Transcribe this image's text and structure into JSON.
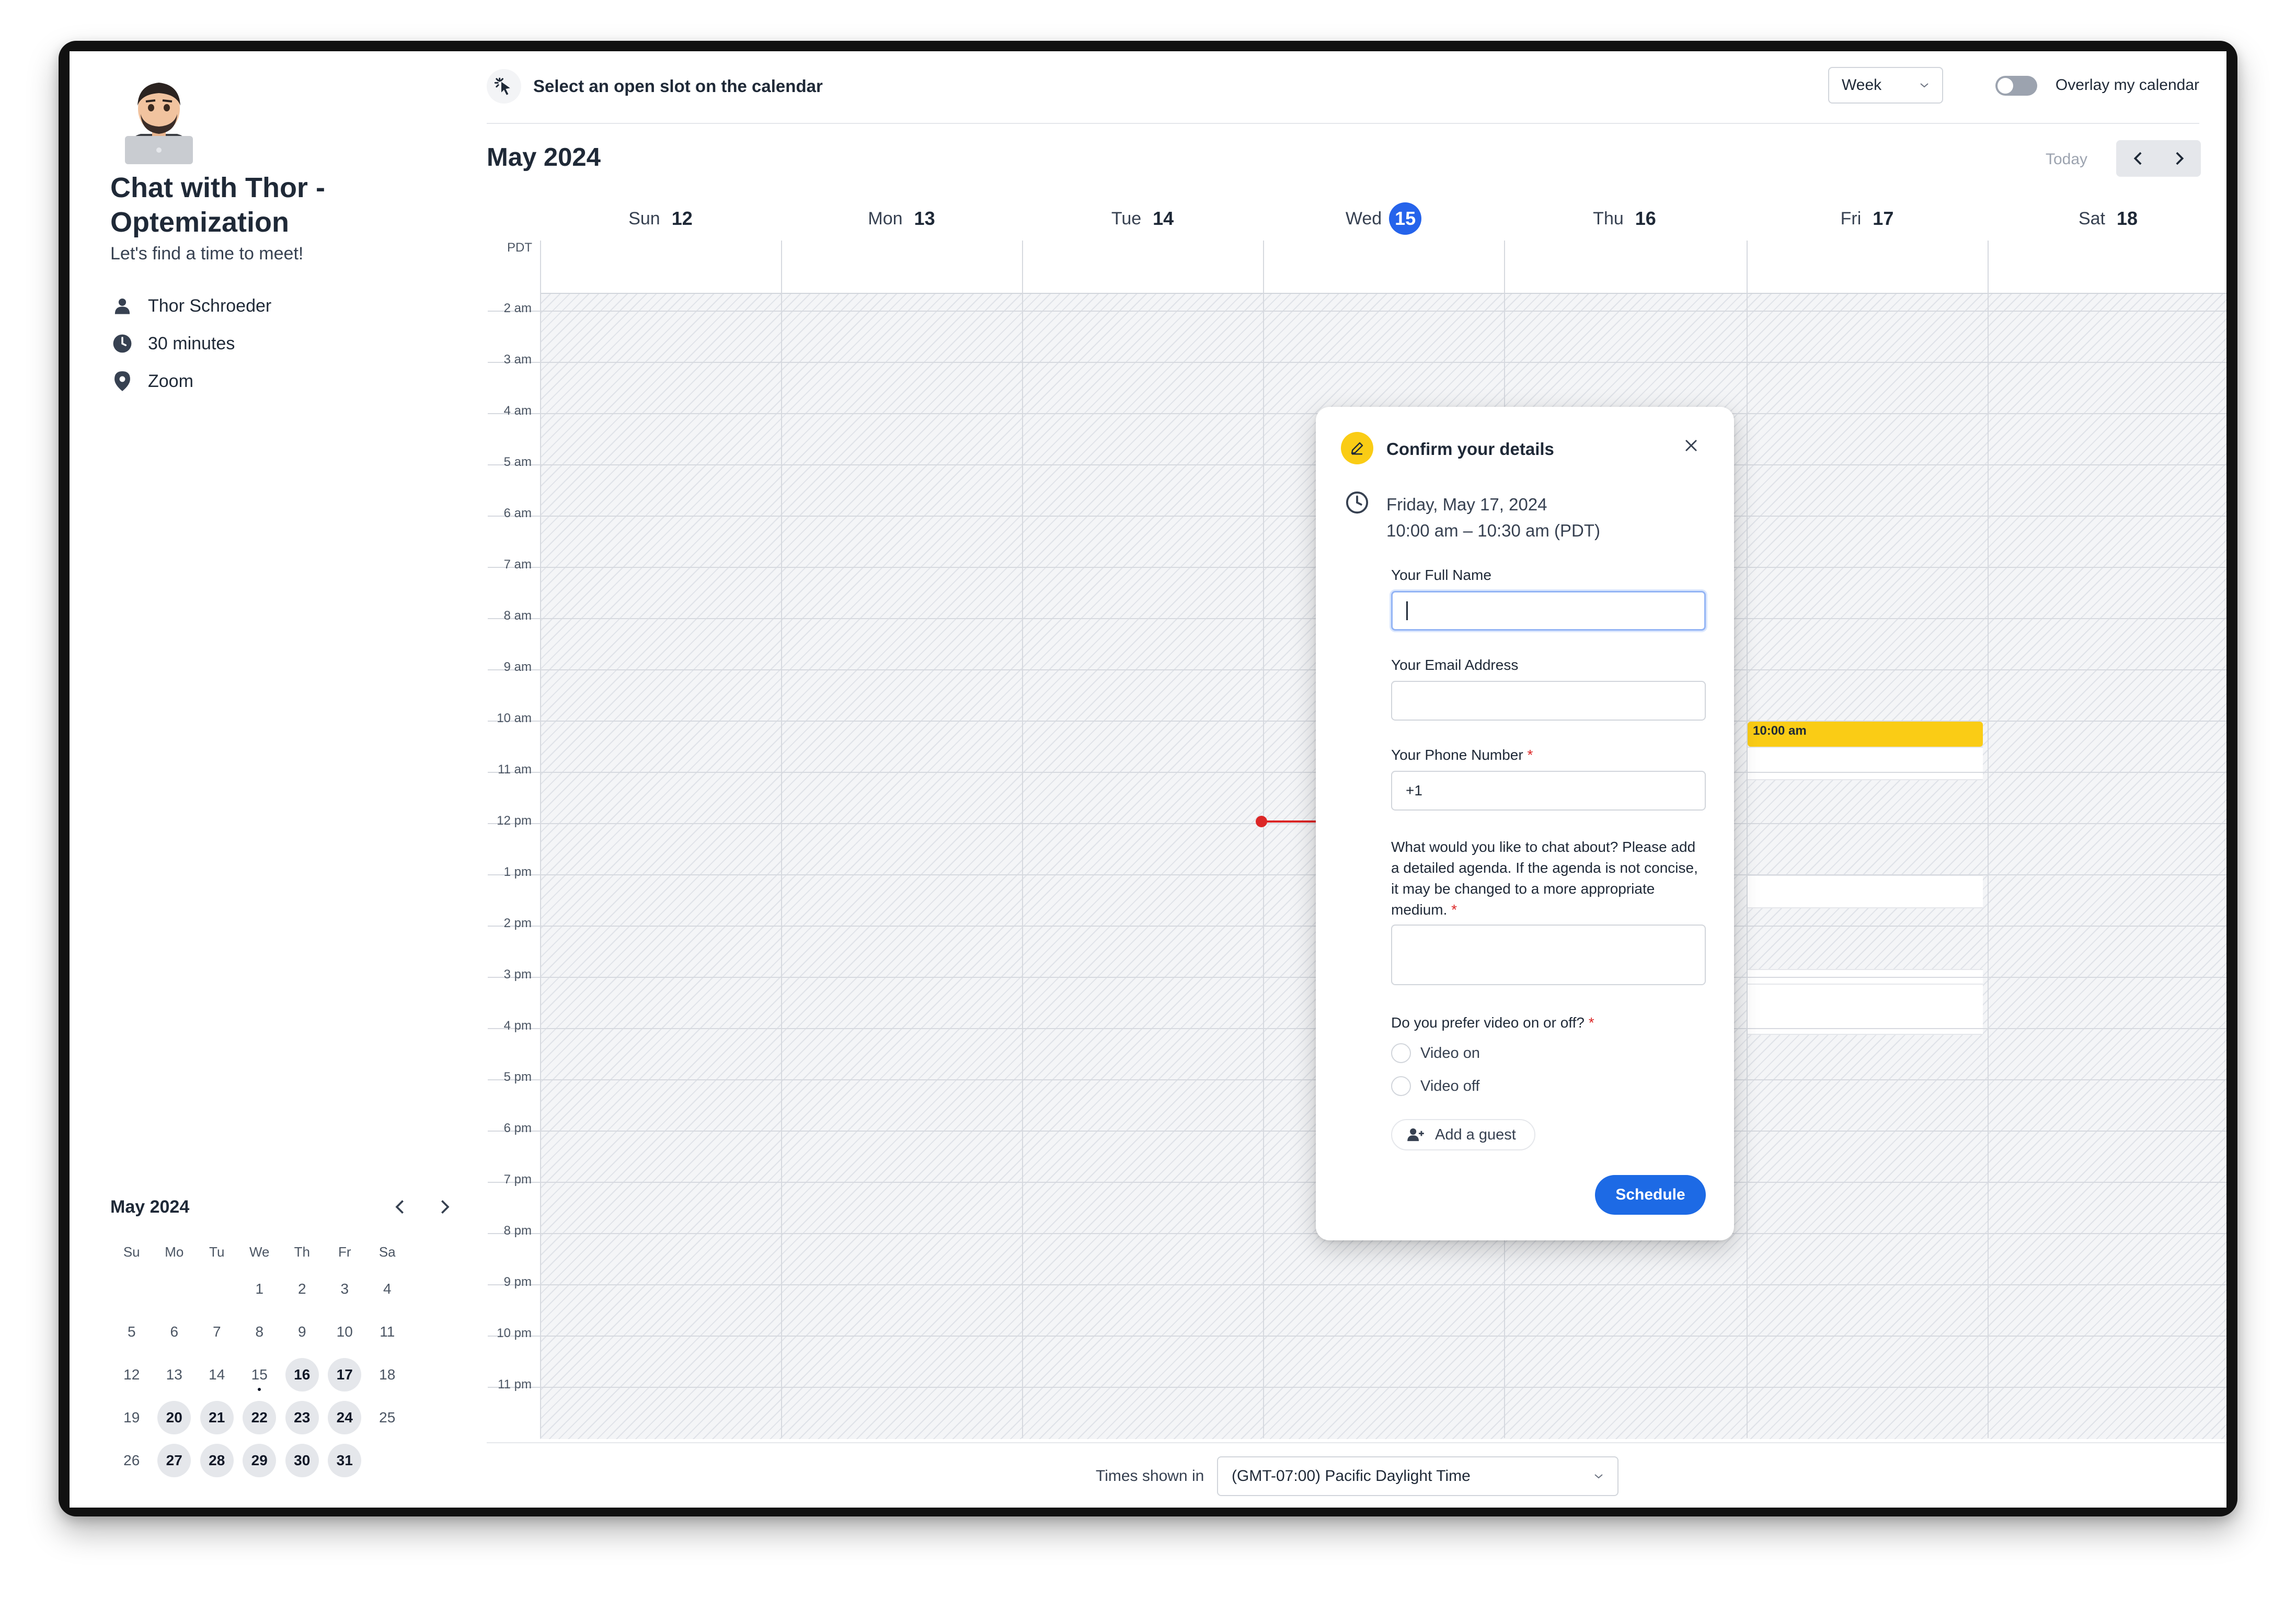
{
  "topbar": {
    "hint": "Select an open slot on the calendar",
    "view_select": "Week",
    "overlay_label": "Overlay my calendar"
  },
  "sidebar": {
    "title": "Chat with Thor - Optemization",
    "subtitle": "Let's find a time to meet!",
    "host": "Thor Schroeder",
    "duration": "30 minutes",
    "location": "Zoom"
  },
  "mini_calendar": {
    "title": "May 2024",
    "weekdays": [
      "Su",
      "Mo",
      "Tu",
      "We",
      "Th",
      "Fr",
      "Sa"
    ],
    "weeks": [
      [
        "",
        "",
        "",
        "1",
        "2",
        "3",
        "4"
      ],
      [
        "5",
        "6",
        "7",
        "8",
        "9",
        "10",
        "11"
      ],
      [
        "12",
        "13",
        "14",
        "15",
        "16",
        "17",
        "18"
      ],
      [
        "19",
        "20",
        "21",
        "22",
        "23",
        "24",
        "25"
      ],
      [
        "26",
        "27",
        "28",
        "29",
        "30",
        "31",
        ""
      ]
    ],
    "available": [
      "16",
      "17",
      "20",
      "21",
      "22",
      "23",
      "24",
      "27",
      "28",
      "29",
      "30",
      "31"
    ],
    "today": "15"
  },
  "calendar": {
    "month": "May 2024",
    "today_label": "Today",
    "timezone_abbr": "PDT",
    "days": [
      {
        "name": "Sun",
        "num": "12"
      },
      {
        "name": "Mon",
        "num": "13"
      },
      {
        "name": "Tue",
        "num": "14"
      },
      {
        "name": "Wed",
        "num": "15",
        "today": true
      },
      {
        "name": "Thu",
        "num": "16"
      },
      {
        "name": "Fri",
        "num": "17"
      },
      {
        "name": "Sat",
        "num": "18"
      }
    ],
    "hours": [
      "2 am",
      "3 am",
      "4 am",
      "5 am",
      "6 am",
      "7 am",
      "8 am",
      "9 am",
      "10 am",
      "11 am",
      "12 pm",
      "1 pm",
      "2 pm",
      "3 pm",
      "4 pm",
      "5 pm",
      "6 pm",
      "7 pm",
      "8 pm",
      "9 pm",
      "10 pm",
      "11 pm"
    ],
    "selected_event": "10:00 am"
  },
  "footer": {
    "times_label": "Times shown in",
    "timezone": "(GMT-07:00) Pacific Daylight Time"
  },
  "dialog": {
    "title": "Confirm your details",
    "date": "Friday, May 17, 2024",
    "time": "10:00 am – 10:30 am (PDT)",
    "name_label": "Your Full Name",
    "email_label": "Your Email Address",
    "phone_label": "Your Phone Number",
    "phone_value": "+1",
    "agenda_label": "What would you like to chat about? Please add a detailed agenda. If the agenda is not concise, it may be changed to a more appropriate medium.",
    "video_label": "Do you prefer video on or off?",
    "video_on": "Video on",
    "video_off": "Video off",
    "add_guest": "Add a guest",
    "schedule": "Schedule",
    "required_mark": "*"
  },
  "colors": {
    "accent": "#1d6ae5",
    "today": "#2563eb",
    "event": "#facc15",
    "now_line": "#dc2626"
  },
  "icons": [
    "avatar",
    "cursor-click-icon",
    "chevron-down-icon",
    "person-icon",
    "clock-icon",
    "location-pin-icon",
    "chevron-left-icon",
    "chevron-right-icon",
    "pencil-icon",
    "close-icon",
    "add-user-icon"
  ]
}
